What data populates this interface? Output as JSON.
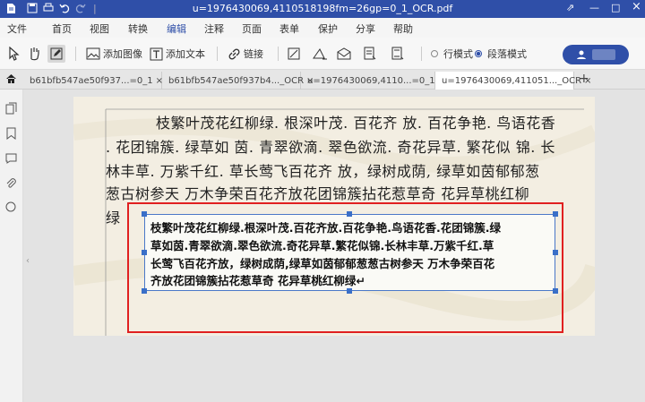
{
  "window": {
    "title": "u=1976430069,4110518198fm=26gp=0_1_OCR.pdf",
    "minimize": "—",
    "restore": "□",
    "close": "×",
    "expand": "⇗"
  },
  "menu": {
    "items": [
      "文件",
      "首页",
      "视图",
      "转换",
      "编辑",
      "注释",
      "页面",
      "表单",
      "保护",
      "分享",
      "帮助"
    ],
    "active": "编辑"
  },
  "toolbar": {
    "add_image": "添加图像",
    "add_text": "添加文本",
    "link": "链接",
    "line_mode": "行模式",
    "paragraph_mode": "段落模式",
    "selected_mode": "段落模式"
  },
  "tabs": [
    {
      "label": "b61bfb547ae50f937...=0_1",
      "close": "×",
      "active": false
    },
    {
      "label": "b61bfb547ae50f937b4..._OCR",
      "close": "×",
      "active": false
    },
    {
      "label": "u=1976430069,4110...=0_1",
      "close": "×",
      "active": false
    },
    {
      "label": "u=1976430069,411051..._OCR",
      "close": "×",
      "active": true
    }
  ],
  "new_tab": "+",
  "document": {
    "original_lines": [
      "枝繁叶茂花红柳绿. 根深叶茂. 百花齐  放. 百花争艳. 鸟语花香",
      ". 花团锦簇. 绿草如  茵. 青翠欲滴. 翠色欲流. 奇花异草. 繁花似  锦. 长",
      "林丰草. 万紫千红. 草长莺飞百花齐  放，绿树成荫, 绿草如茵郁郁葱",
      "葱古树参天  万木争荣百花齐放花团锦簇拈花惹草奇  花异草桃红柳",
      "绿"
    ],
    "ocr_lines": [
      "枝繁叶茂花红柳绿.根深叶茂.百花齐放.百花争艳.鸟语花香.花团锦簇.绿",
      "草如茵.青翠欲滴.翠色欲流.奇花异草.繁花似锦.长林丰草.万紫千红.草",
      "长莺飞百花齐放，绿树成荫,绿草如茵郁郁葱葱古树参天 万木争荣百花",
      "齐放花团锦簇拈花惹草奇 花异草桃红柳绿↵"
    ]
  },
  "colors": {
    "accent": "#2f4fa8",
    "selection": "#e02020",
    "handle": "#3a6fc8"
  }
}
